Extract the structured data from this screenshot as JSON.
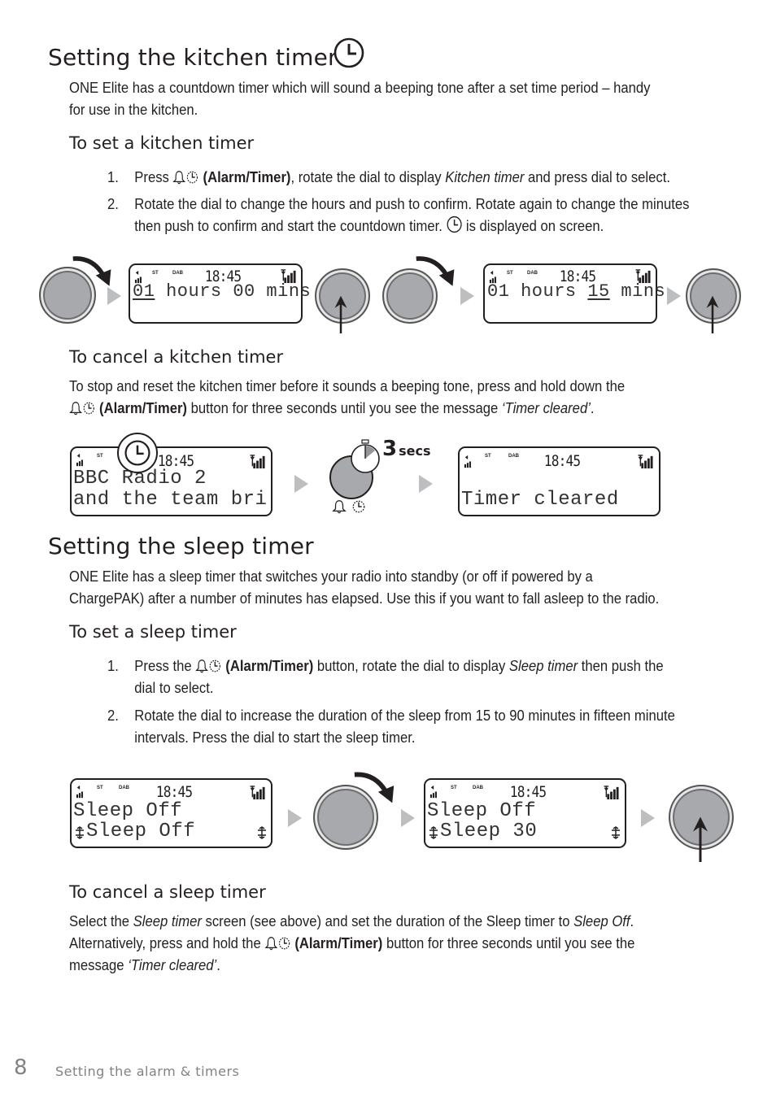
{
  "kitchen": {
    "title": "Setting the kitchen timer",
    "intro_1": "ONE Elite has a countdown timer which will sound a beeping tone after a set time period – handy",
    "intro_2": "for use in the kitchen.",
    "set_heading": "To set a kitchen timer",
    "steps": [
      {
        "num": "1.",
        "pre": "Press",
        "button": "(Alarm/Timer)",
        "mid": ", rotate the dial to display ",
        "italic": "Kitchen timer",
        "post": " and press dial to select."
      },
      {
        "num": "2.",
        "line1": "Rotate the dial to change the hours and push to confirm. Rotate again to change the minutes",
        "line2_pre": "then push to confirm and start the countdown timer.",
        "line2_post": "is displayed on screen."
      }
    ],
    "displays": [
      {
        "st": "ST",
        "dab": "DAB",
        "time": "18:45",
        "hours": "01",
        "hours_label": " hours ",
        "mins": "00",
        "mins_label": " mins",
        "underline": "hours"
      },
      {
        "st": "ST",
        "dab": "DAB",
        "time": "18:45",
        "hours": "01",
        "hours_label": " hours ",
        "mins": "15",
        "mins_label": " mins",
        "underline": "mins"
      }
    ],
    "cancel_heading": "To cancel a kitchen timer",
    "cancel_1": "To stop and reset the kitchen timer before it sounds a beeping tone, press and hold down the",
    "cancel_2_button": "(Alarm/Timer)",
    "cancel_2_mid": " button for three seconds until you see the message ",
    "cancel_2_italic": "‘Timer cleared’",
    "cancel_2_end": ".",
    "cancel_displays": [
      {
        "st": "ST",
        "time": "18:45",
        "line1": "BBC Radio 2",
        "line2": "and the team bri"
      },
      {
        "st": "ST",
        "dab": "DAB",
        "time": "18:45",
        "line1": "",
        "line2": "Timer cleared"
      }
    ],
    "hold_label_num": "3",
    "hold_label_unit": "secs"
  },
  "sleep": {
    "title": "Setting the sleep timer",
    "intro_1": "ONE Elite has a sleep timer that switches your radio into standby (or off if powered by a",
    "intro_2": "ChargePAK) after a number of minutes has elapsed. Use this if you want to fall asleep to the radio.",
    "set_heading": "To set a sleep timer",
    "steps": [
      {
        "num": "1.",
        "pre": "Press the",
        "button": "(Alarm/Timer)",
        "mid": " button, rotate the dial to display ",
        "italic": "Sleep timer",
        "post": " then push the",
        "line2": "dial to select."
      },
      {
        "num": "2.",
        "line1": "Rotate the dial to increase the duration of the sleep from 15 to 90 minutes in fifteen minute",
        "line2": "intervals. Press the dial to start the sleep timer."
      }
    ],
    "displays": [
      {
        "st": "ST",
        "dab": "DAB",
        "time": "18:45",
        "line1": "Sleep Off",
        "line2": "Sleep Off"
      },
      {
        "st": "ST",
        "dab": "DAB",
        "time": "18:45",
        "line1": "Sleep Off",
        "line2": "Sleep 30"
      }
    ],
    "cancel_heading": "To cancel a sleep timer",
    "cancel_1_pre": "Select the ",
    "cancel_1_italic1": "Sleep timer",
    "cancel_1_mid": " screen (see above) and set the duration of the Sleep timer to ",
    "cancel_1_italic2": "Sleep Off",
    "cancel_1_end": ".",
    "cancel_2_pre": "Alternatively, press and hold the",
    "cancel_2_button": "(Alarm/Timer)",
    "cancel_2_post": " button for three seconds until you see the",
    "cancel_3_pre": "message ",
    "cancel_3_italic": "‘Timer cleared’",
    "cancel_3_end": "."
  },
  "footer": {
    "page_number": "8",
    "section": "Setting the alarm & timers"
  },
  "icons": {
    "clock": "clock-icon",
    "bell": "bell-icon",
    "timer": "timer-icon",
    "dial": "dial-knob",
    "rotate_arrow": "rotate-arrow-icon",
    "push_arrow": "push-arrow-icon",
    "next": "triangle-next-icon",
    "stopwatch": "stopwatch-icon"
  }
}
